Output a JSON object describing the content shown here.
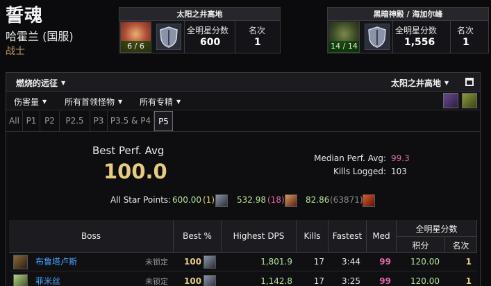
{
  "character": {
    "name": "誓魂",
    "server": "哈霍兰 (国服)",
    "class": "战士"
  },
  "zone_cards": [
    {
      "title": "太阳之井高地",
      "progress": "6 / 6",
      "score_label": "全明星分数",
      "score_value": "600",
      "rank_label": "名次",
      "rank_value": "1"
    },
    {
      "title": "黑暗神殿 / 海加尔峰",
      "progress": "14 / 14",
      "score_label": "全明星分数",
      "score_value": "1,556",
      "rank_label": "名次",
      "rank_value": "1"
    }
  ],
  "filters": {
    "expansion": "燃烧的远征",
    "zone": "太阳之井高地",
    "metric": "伤害量",
    "bosses": "所有首领怪物",
    "specs": "所有专精"
  },
  "phase_tabs": [
    "All",
    "P1",
    "P2",
    "P2.5",
    "P3",
    "P3.5 & P4",
    "P5"
  ],
  "active_tab": "P5",
  "summary": {
    "best_perf_label": "Best Perf. Avg",
    "best_perf_value": "100.0",
    "median_label": "Median Perf. Avg:",
    "median_value": "99.3",
    "kills_label": "Kills Logged:",
    "kills_value": "103",
    "all_star_label": "All Star Points:",
    "all_star_1_points": "600.00",
    "all_star_1_rank": "(1)",
    "all_star_2_points": "532.98",
    "all_star_2_rank": "(18)",
    "all_star_3_points": "82.86",
    "all_star_3_rank": "(63871)"
  },
  "table": {
    "headers": {
      "boss": "Boss",
      "best": "Best %",
      "dps": "Highest DPS",
      "kills": "Kills",
      "fastest": "Fastest",
      "med": "Med",
      "allstar": "全明星分数",
      "points": "积分",
      "rank": "名次"
    },
    "rows": [
      {
        "boss": "布鲁塔卢斯",
        "lock": "未锁定",
        "best": "100",
        "dps": "1,801.9",
        "kills": "17",
        "fastest": "3:44",
        "med": "99",
        "points": "120.00",
        "rank": "1"
      },
      {
        "boss": "菲米丝",
        "lock": "未锁定",
        "best": "100",
        "dps": "1,142.8",
        "kills": "17",
        "fastest": "3:25",
        "med": "99",
        "points": "120.00",
        "rank": "1"
      }
    ]
  },
  "colors": {
    "legendary": "#e5cc80",
    "pink": "#e268a8",
    "green": "#b5e29a",
    "class": "#c69b6d",
    "boss_name": "#4da3ff"
  }
}
